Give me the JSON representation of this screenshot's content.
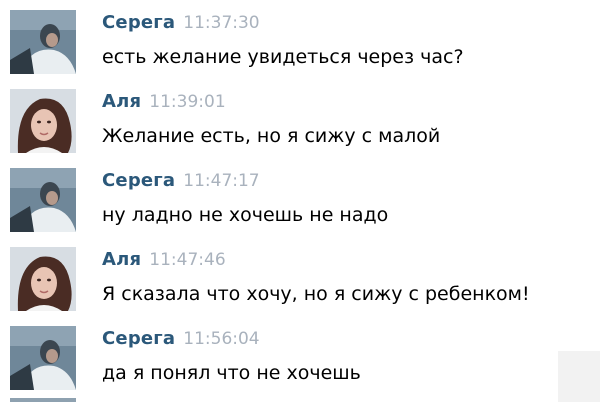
{
  "messages": [
    {
      "author": "Серега",
      "time": "11:37:30",
      "text": "есть желание увидеться через час?",
      "avatar": "avatar-sergey"
    },
    {
      "author": "Аля",
      "time": "11:39:01",
      "text": "Желание есть, но я сижу с малой",
      "avatar": "avatar-alya"
    },
    {
      "author": "Серега",
      "time": "11:47:17",
      "text": "ну ладно не хочешь не надо",
      "avatar": "avatar-sergey"
    },
    {
      "author": "Аля",
      "time": "11:47:46",
      "text": "Я сказала что хочу, но я сижу с ребенком!",
      "avatar": "avatar-alya"
    },
    {
      "author": "Серега",
      "time": "11:56:04",
      "text": "да я понял что не хочешь",
      "avatar": "avatar-sergey"
    }
  ],
  "colors": {
    "author": "#2b587a",
    "time": "#a9b2bd",
    "text": "#000000"
  }
}
